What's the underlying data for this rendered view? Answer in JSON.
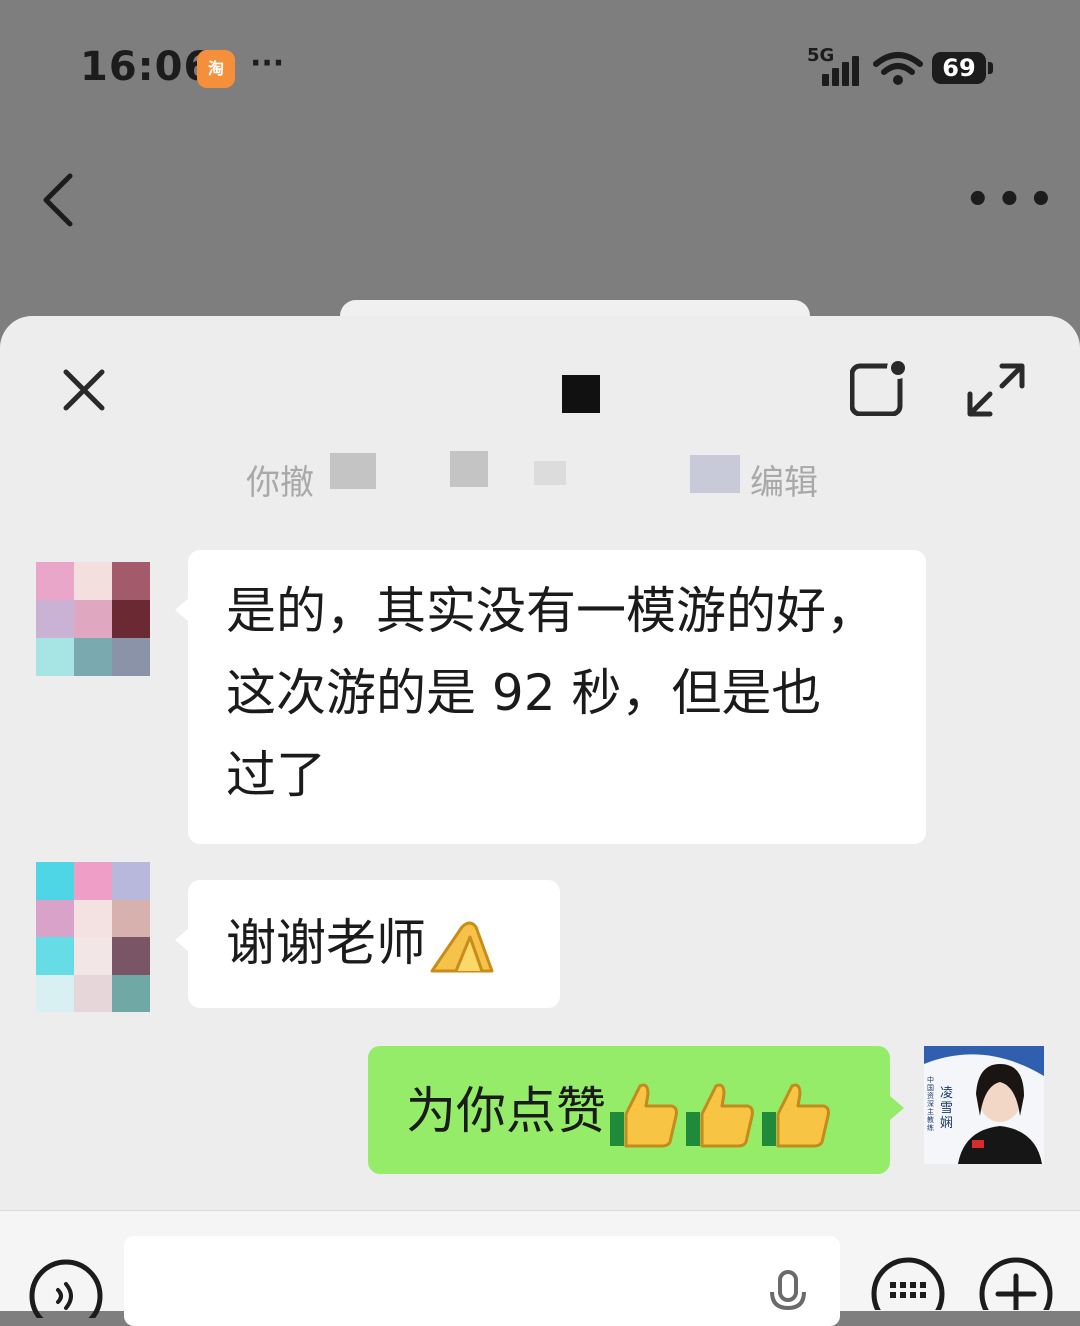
{
  "status_bar": {
    "time": "16:06",
    "taobao_badge": "淘",
    "more": "···",
    "network": "5G",
    "battery": "69"
  },
  "top_bar": {
    "more": "•••"
  },
  "system_message": {
    "part_a": "你撤",
    "part_b": "编辑"
  },
  "messages": [
    {
      "from": "other",
      "lines": [
        "是的，其实没有一模游的好，",
        "这次游的是 92 秒，但是也",
        "过了"
      ]
    },
    {
      "from": "other",
      "text": "谢谢老师"
    },
    {
      "from": "me",
      "text": "为你点赞"
    }
  ],
  "me_avatar": {
    "label": "凌雪娴",
    "caption": "中国资深主教练"
  },
  "icons": [
    "back-arrow-icon",
    "close-icon",
    "stop-icon",
    "floating-window-icon",
    "expand-icon",
    "voice-icon",
    "microphone-icon",
    "keyboard-icon",
    "plus-icon"
  ]
}
